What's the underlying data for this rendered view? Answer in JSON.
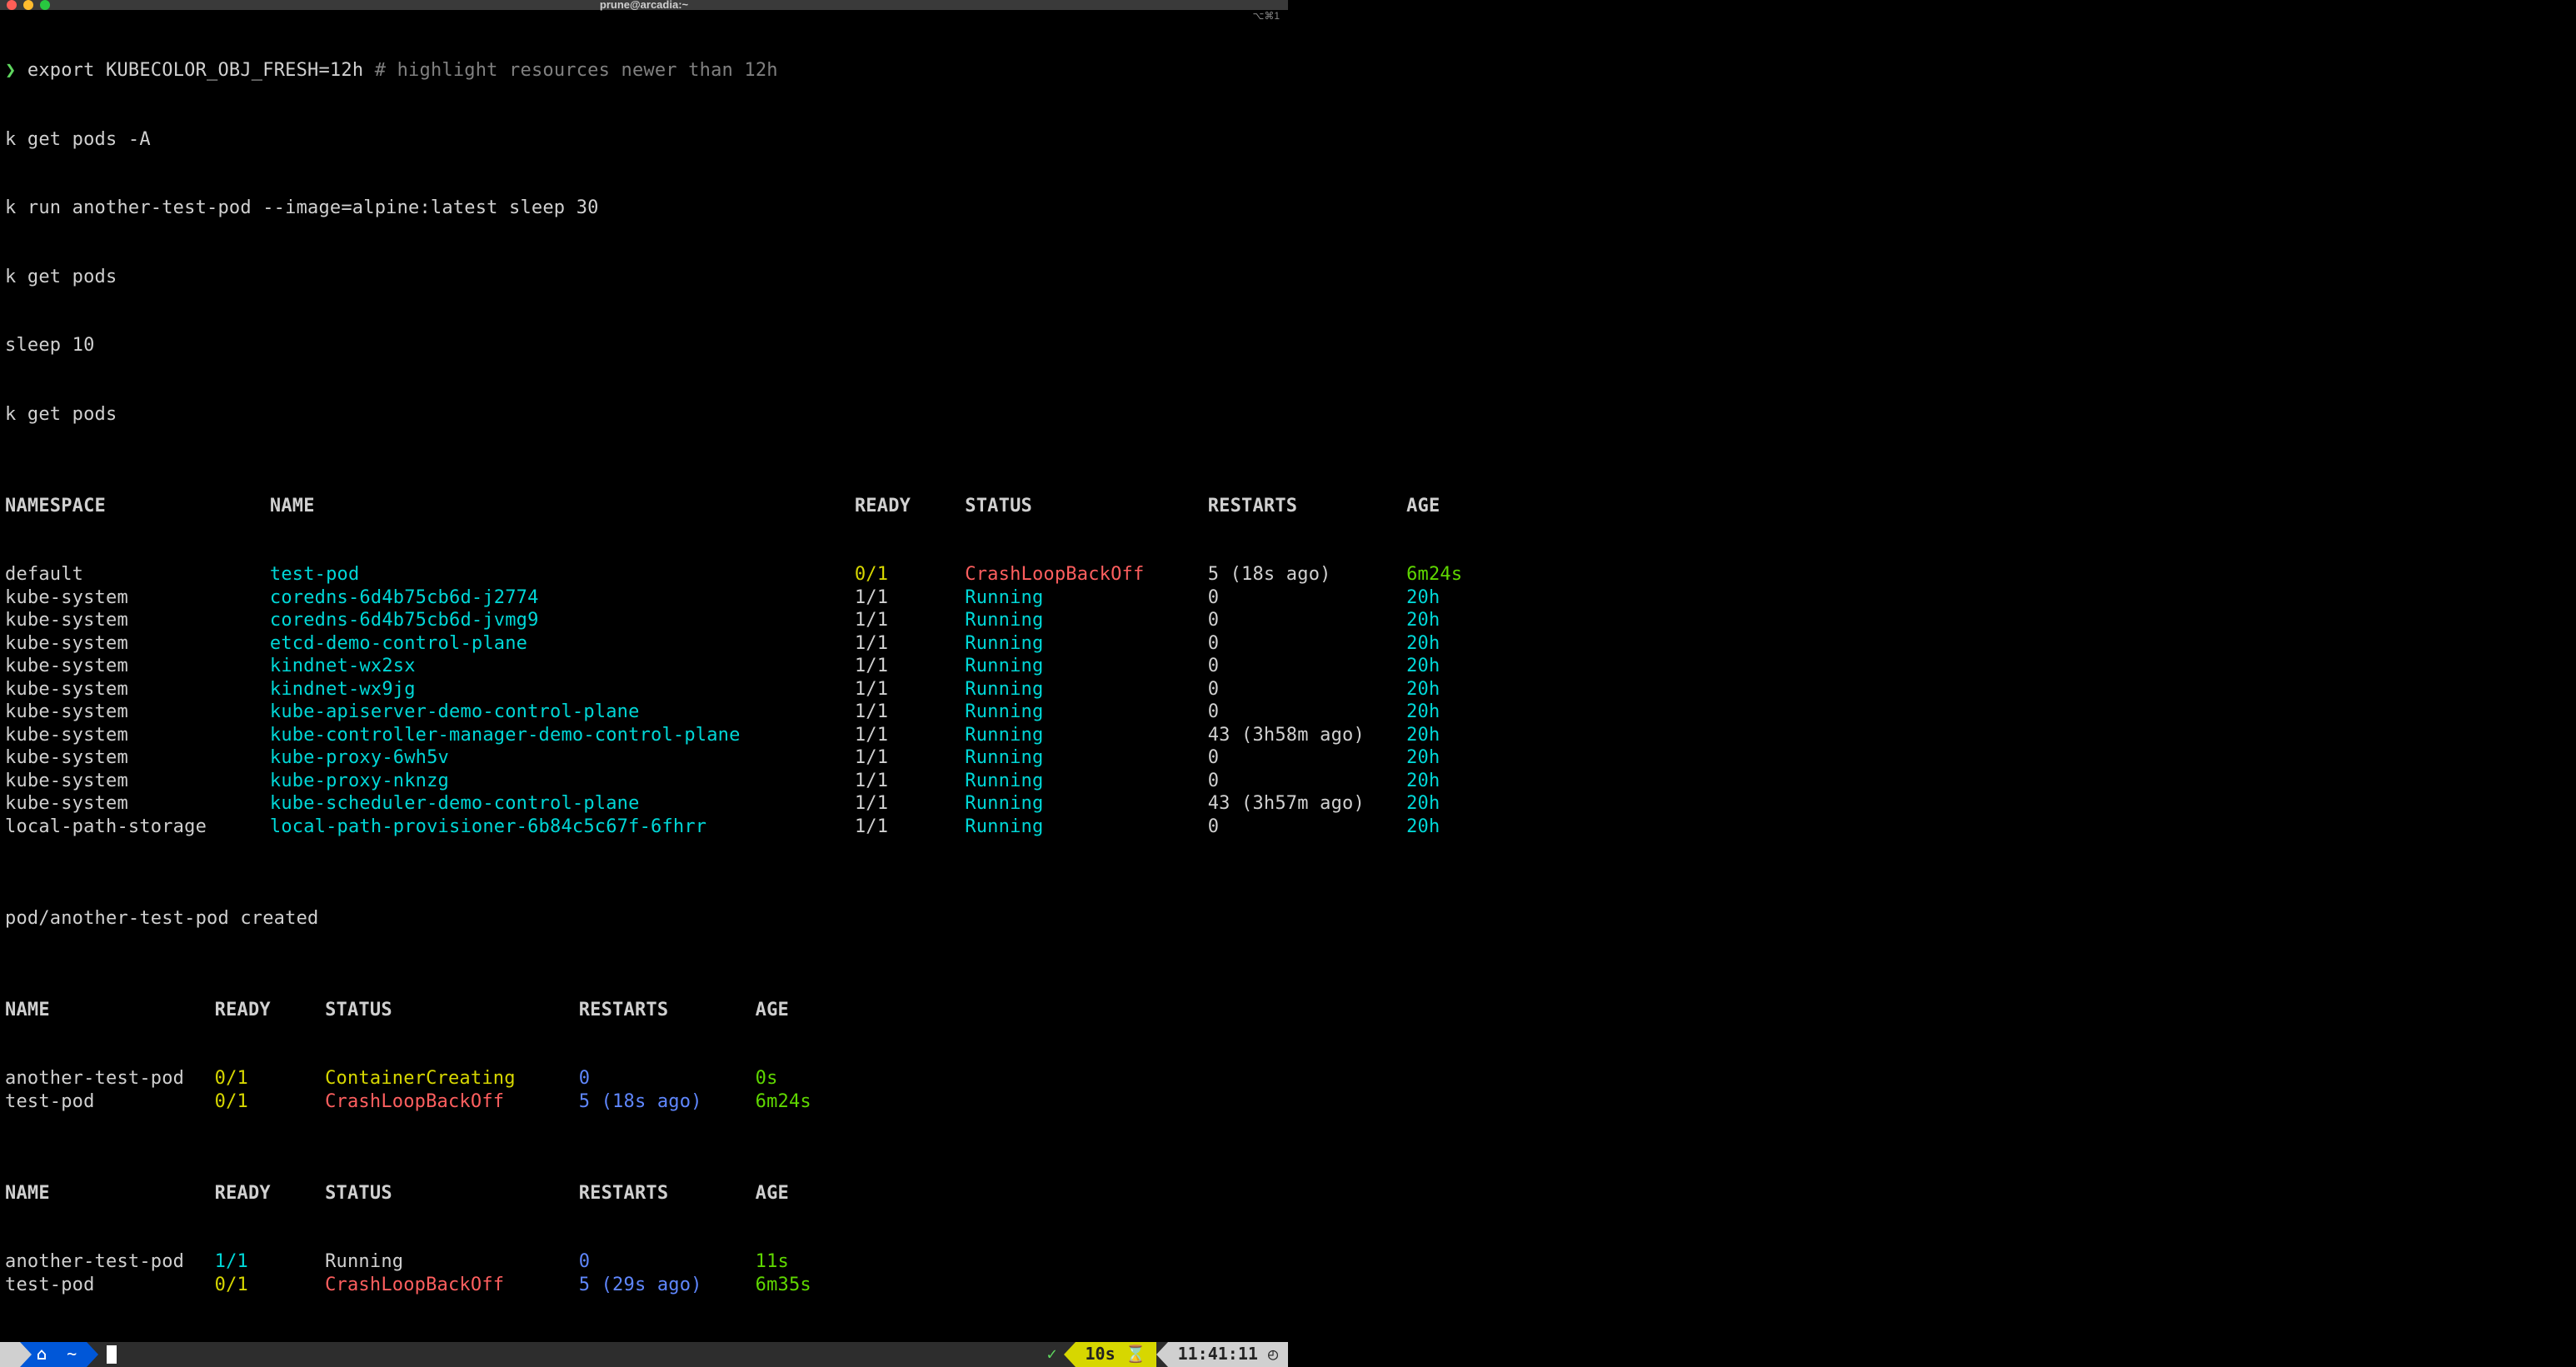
{
  "titlebar": {
    "title": "prune@arcadia:~",
    "right_glyph": "⌥⌘1"
  },
  "prompt": {
    "symbol": "❯"
  },
  "commands": {
    "line1_cmd": "export KUBECOLOR_OBJ_FRESH=12h ",
    "line1_comment": "# highlight resources newer than 12h",
    "line2": "k get pods -A",
    "line3": "k run another-test-pod --image=alpine:latest sleep 30",
    "line4": "k get pods",
    "line5": "sleep 10",
    "line6": "k get pods"
  },
  "table1": {
    "headers": {
      "ns": "NAMESPACE",
      "name": "NAME",
      "ready": "READY",
      "status": "STATUS",
      "restarts": "RESTARTS",
      "age": "AGE"
    },
    "rows": [
      {
        "ns": "default",
        "name": "test-pod",
        "ready": "0/1",
        "status": "CrashLoopBackOff",
        "restarts": "5 (18s ago)",
        "age": "6m24s",
        "ns_cls": "white",
        "nm_cls": "cyan",
        "rd_cls": "yellow",
        "st_cls": "red",
        "rs_cls": "white",
        "ag_cls": "green"
      },
      {
        "ns": "kube-system",
        "name": "coredns-6d4b75cb6d-j2774",
        "ready": "1/1",
        "status": "Running",
        "restarts": "0",
        "age": "20h",
        "ns_cls": "white",
        "nm_cls": "cyan",
        "rd_cls": "white",
        "st_cls": "cyan",
        "rs_cls": "white",
        "ag_cls": "cyan"
      },
      {
        "ns": "kube-system",
        "name": "coredns-6d4b75cb6d-jvmg9",
        "ready": "1/1",
        "status": "Running",
        "restarts": "0",
        "age": "20h",
        "ns_cls": "white",
        "nm_cls": "cyan",
        "rd_cls": "white",
        "st_cls": "cyan",
        "rs_cls": "white",
        "ag_cls": "cyan"
      },
      {
        "ns": "kube-system",
        "name": "etcd-demo-control-plane",
        "ready": "1/1",
        "status": "Running",
        "restarts": "0",
        "age": "20h",
        "ns_cls": "white",
        "nm_cls": "cyan",
        "rd_cls": "white",
        "st_cls": "cyan",
        "rs_cls": "white",
        "ag_cls": "cyan"
      },
      {
        "ns": "kube-system",
        "name": "kindnet-wx2sx",
        "ready": "1/1",
        "status": "Running",
        "restarts": "0",
        "age": "20h",
        "ns_cls": "white",
        "nm_cls": "cyan",
        "rd_cls": "white",
        "st_cls": "cyan",
        "rs_cls": "white",
        "ag_cls": "cyan"
      },
      {
        "ns": "kube-system",
        "name": "kindnet-wx9jg",
        "ready": "1/1",
        "status": "Running",
        "restarts": "0",
        "age": "20h",
        "ns_cls": "white",
        "nm_cls": "cyan",
        "rd_cls": "white",
        "st_cls": "cyan",
        "rs_cls": "white",
        "ag_cls": "cyan"
      },
      {
        "ns": "kube-system",
        "name": "kube-apiserver-demo-control-plane",
        "ready": "1/1",
        "status": "Running",
        "restarts": "0",
        "age": "20h",
        "ns_cls": "white",
        "nm_cls": "cyan",
        "rd_cls": "white",
        "st_cls": "cyan",
        "rs_cls": "white",
        "ag_cls": "cyan"
      },
      {
        "ns": "kube-system",
        "name": "kube-controller-manager-demo-control-plane",
        "ready": "1/1",
        "status": "Running",
        "restarts": "43 (3h58m ago)",
        "age": "20h",
        "ns_cls": "white",
        "nm_cls": "cyan",
        "rd_cls": "white",
        "st_cls": "cyan",
        "rs_cls": "white",
        "ag_cls": "cyan"
      },
      {
        "ns": "kube-system",
        "name": "kube-proxy-6wh5v",
        "ready": "1/1",
        "status": "Running",
        "restarts": "0",
        "age": "20h",
        "ns_cls": "white",
        "nm_cls": "cyan",
        "rd_cls": "white",
        "st_cls": "cyan",
        "rs_cls": "white",
        "ag_cls": "cyan"
      },
      {
        "ns": "kube-system",
        "name": "kube-proxy-nknzg",
        "ready": "1/1",
        "status": "Running",
        "restarts": "0",
        "age": "20h",
        "ns_cls": "white",
        "nm_cls": "cyan",
        "rd_cls": "white",
        "st_cls": "cyan",
        "rs_cls": "white",
        "ag_cls": "cyan"
      },
      {
        "ns": "kube-system",
        "name": "kube-scheduler-demo-control-plane",
        "ready": "1/1",
        "status": "Running",
        "restarts": "43 (3h57m ago)",
        "age": "20h",
        "ns_cls": "white",
        "nm_cls": "cyan",
        "rd_cls": "white",
        "st_cls": "cyan",
        "rs_cls": "white",
        "ag_cls": "cyan"
      },
      {
        "ns": "local-path-storage",
        "name": "local-path-provisioner-6b84c5c67f-6fhrr",
        "ready": "1/1",
        "status": "Running",
        "restarts": "0",
        "age": "20h",
        "ns_cls": "white",
        "nm_cls": "cyan",
        "rd_cls": "white",
        "st_cls": "cyan",
        "rs_cls": "white",
        "ag_cls": "cyan"
      }
    ]
  },
  "created_line": "pod/another-test-pod created",
  "table2": {
    "headers": {
      "name": "NAME",
      "ready": "READY",
      "status": "STATUS",
      "restarts": "RESTARTS",
      "age": "AGE"
    },
    "rows": [
      {
        "name": "another-test-pod",
        "ready": "0/1",
        "status": "ContainerCreating",
        "restarts": "0",
        "age": "0s",
        "nm_cls": "white",
        "rd_cls": "yellow",
        "st_cls": "yellow",
        "rs_cls": "bluep",
        "ag_cls": "green"
      },
      {
        "name": "test-pod",
        "ready": "0/1",
        "status": "CrashLoopBackOff",
        "restarts": "5 (18s ago)",
        "age": "6m24s",
        "nm_cls": "white",
        "rd_cls": "yellow",
        "st_cls": "red",
        "rs_cls": "bluep",
        "ag_cls": "green"
      }
    ]
  },
  "table3": {
    "headers": {
      "name": "NAME",
      "ready": "READY",
      "status": "STATUS",
      "restarts": "RESTARTS",
      "age": "AGE"
    },
    "rows": [
      {
        "name": "another-test-pod",
        "ready": "1/1",
        "status": "Running",
        "restarts": "0",
        "age": "11s",
        "nm_cls": "white",
        "rd_cls": "cyan",
        "st_cls": "white",
        "rs_cls": "bluep",
        "ag_cls": "green"
      },
      {
        "name": "test-pod",
        "ready": "0/1",
        "status": "CrashLoopBackOff",
        "restarts": "5 (29s ago)",
        "age": "6m35s",
        "nm_cls": "white",
        "rd_cls": "yellow",
        "st_cls": "red",
        "rs_cls": "bluep",
        "ag_cls": "green"
      }
    ]
  },
  "statusbar": {
    "apple": "",
    "home": "⌂",
    "tilde": "~",
    "check": "✓",
    "timer": "10s",
    "hourglass": "⌛",
    "clock_time": "11:41:11",
    "clock_icon": "◴"
  }
}
